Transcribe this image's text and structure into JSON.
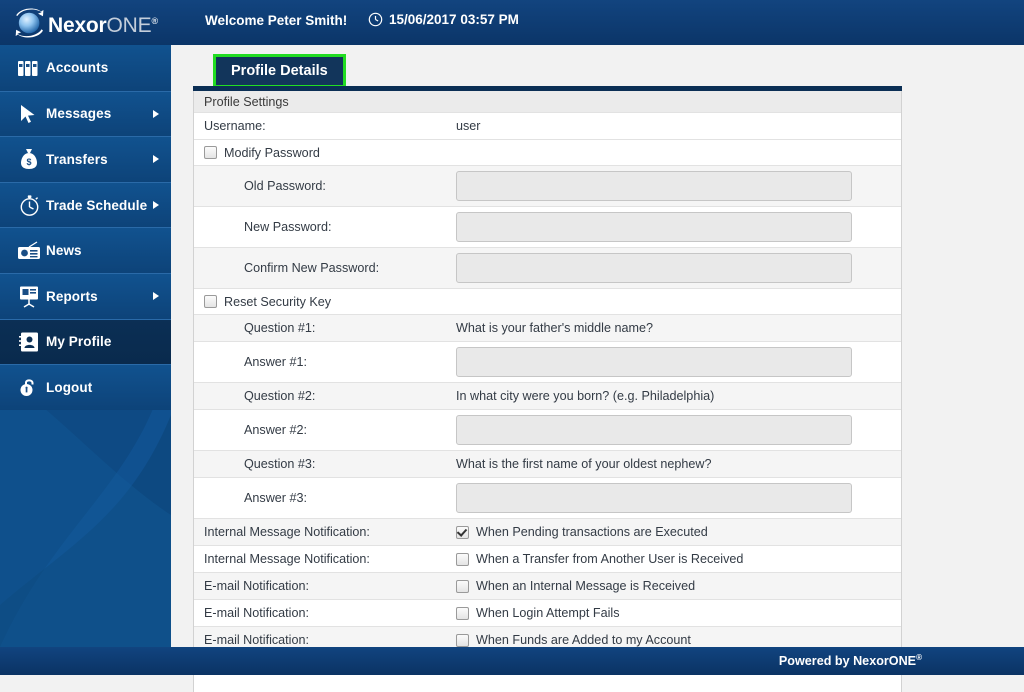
{
  "header": {
    "logo_nexor": "Nexor",
    "logo_one": "ONE",
    "logo_reg": "®",
    "welcome": "Welcome Peter Smith!",
    "datetime": "15/06/2017 03:57 PM",
    "clock_icon": "clock-icon",
    "bg_color": "#0d3b71"
  },
  "sidebar": {
    "items": [
      {
        "label": "Accounts",
        "icon": "accounts-icon",
        "has_submenu": false,
        "active": false
      },
      {
        "label": "Messages",
        "icon": "cursor-icon",
        "has_submenu": true,
        "active": false
      },
      {
        "label": "Transfers",
        "icon": "money-bag-icon",
        "has_submenu": true,
        "active": false
      },
      {
        "label": "Trade Schedule",
        "icon": "stopwatch-icon",
        "has_submenu": true,
        "active": false
      },
      {
        "label": "News",
        "icon": "radio-icon",
        "has_submenu": false,
        "active": false
      },
      {
        "label": "Reports",
        "icon": "presentation-icon",
        "has_submenu": true,
        "active": false
      },
      {
        "label": "My Profile",
        "icon": "contact-card-icon",
        "has_submenu": false,
        "active": true
      },
      {
        "label": "Logout",
        "icon": "padlock-icon",
        "has_submenu": false,
        "active": false
      }
    ]
  },
  "main": {
    "tab_label": "Profile Details",
    "tab_highlight_color": "#22dd22",
    "section_title": "Profile Settings",
    "username_label": "Username:",
    "username_value": "user",
    "modify_password": {
      "label": "Modify Password",
      "checked": false,
      "fields": [
        {
          "label": "Old Password:",
          "value": "",
          "disabled": true
        },
        {
          "label": "New Password:",
          "value": "",
          "disabled": true
        },
        {
          "label": "Confirm New Password:",
          "value": "",
          "disabled": true
        }
      ]
    },
    "reset_security_key": {
      "label": "Reset Security Key",
      "checked": false,
      "questions": [
        {
          "q_label": "Question #1:",
          "q_value": "What is your father's middle name?",
          "a_label": "Answer #1:",
          "a_value": ""
        },
        {
          "q_label": "Question #2:",
          "q_value": "In what city were you born? (e.g. Philadelphia)",
          "a_label": "Answer #2:",
          "a_value": ""
        },
        {
          "q_label": "Question #3:",
          "q_value": "What is the first name of your oldest nephew?",
          "a_label": "Answer #3:",
          "a_value": ""
        }
      ]
    },
    "notifications": [
      {
        "label": "Internal Message Notification:",
        "text": "When Pending transactions are Executed",
        "checked": true
      },
      {
        "label": "Internal Message Notification:",
        "text": "When a Transfer from Another User is Received",
        "checked": false
      },
      {
        "label": "E-mail Notification:",
        "text": "When an Internal Message is Received",
        "checked": false
      },
      {
        "label": "E-mail Notification:",
        "text": "When Login Attempt Fails",
        "checked": false
      },
      {
        "label": "E-mail Notification:",
        "text": "When Funds are Added to my Account",
        "checked": false
      }
    ]
  },
  "footer": {
    "text": "Powered by NexorONE",
    "reg": "®"
  }
}
